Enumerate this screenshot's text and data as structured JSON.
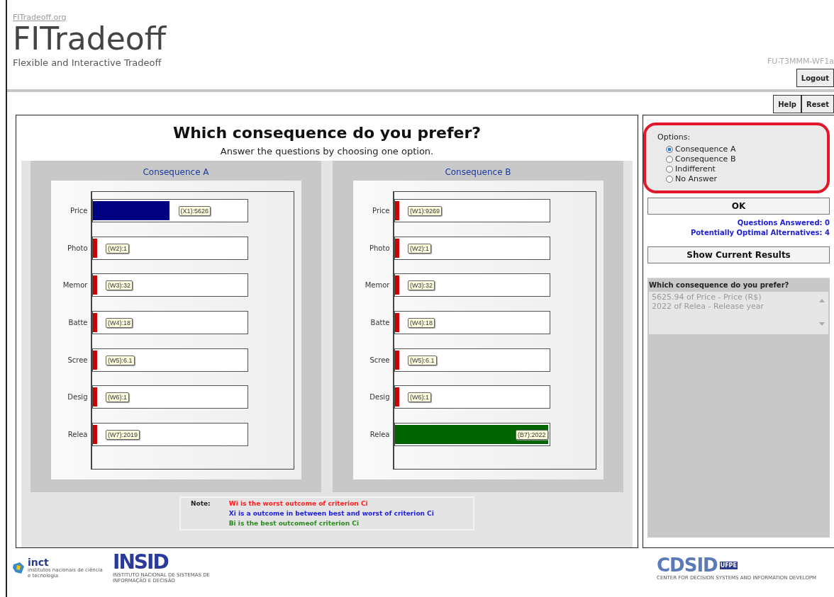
{
  "header": {
    "site_link": "FITradeoff.org",
    "title": "FITradeoff",
    "subtitle": "Flexible and Interactive Tradeoff",
    "user_code": "FU-T3MMM-WF1a",
    "logout": "Logout",
    "help": "Help",
    "reset": "Reset"
  },
  "question": {
    "title": "Which consequence do you prefer?",
    "instruction": "Answer the questions by choosing one option."
  },
  "consequences": [
    {
      "title": "Consequence A",
      "rows": [
        {
          "criterion": "Price",
          "kind": "between",
          "level": 0.5,
          "tag": "(X1):5626"
        },
        {
          "criterion": "Photo",
          "kind": "worst",
          "level": 0.03,
          "tag": "(W2):1"
        },
        {
          "criterion": "Memor",
          "kind": "worst",
          "level": 0.03,
          "tag": "(W3):32"
        },
        {
          "criterion": "Batte",
          "kind": "worst",
          "level": 0.03,
          "tag": "(W4):18"
        },
        {
          "criterion": "Scree",
          "kind": "worst",
          "level": 0.03,
          "tag": "(W5):6.1"
        },
        {
          "criterion": "Desig",
          "kind": "worst",
          "level": 0.03,
          "tag": "(W6):1"
        },
        {
          "criterion": "Relea",
          "kind": "worst",
          "level": 0.03,
          "tag": "(W7):2019"
        }
      ]
    },
    {
      "title": "Consequence B",
      "rows": [
        {
          "criterion": "Price",
          "kind": "worst",
          "level": 0.03,
          "tag": "(W1):9269"
        },
        {
          "criterion": "Photo",
          "kind": "worst",
          "level": 0.03,
          "tag": "(W2):1"
        },
        {
          "criterion": "Memor",
          "kind": "worst",
          "level": 0.03,
          "tag": "(W3):32"
        },
        {
          "criterion": "Batte",
          "kind": "worst",
          "level": 0.03,
          "tag": "(W4):18"
        },
        {
          "criterion": "Scree",
          "kind": "worst",
          "level": 0.03,
          "tag": "(W5):6.1"
        },
        {
          "criterion": "Desig",
          "kind": "worst",
          "level": 0.03,
          "tag": "(W6):1"
        },
        {
          "criterion": "Relea",
          "kind": "best",
          "level": 1,
          "tag": "(B7):2022"
        }
      ]
    }
  ],
  "note": {
    "label": "Note:",
    "lines": [
      {
        "text": "Wi is the worst outcome of criterion Ci",
        "color": "#ff2020"
      },
      {
        "text": "Xi is a outcome in between best and worst of criterion Ci",
        "color": "#2020e0"
      },
      {
        "text": "Bi is the best outcomeof criterion Ci",
        "color": "#2e8b22"
      }
    ]
  },
  "options": {
    "label": "Options:",
    "items": [
      {
        "label": "Consequence A",
        "selected": true
      },
      {
        "label": "Consequence B",
        "selected": false
      },
      {
        "label": "Indifferent",
        "selected": false
      },
      {
        "label": "No Answer",
        "selected": false
      }
    ]
  },
  "ok_button": "OK",
  "stats": [
    "Questions Answered: 0",
    "Potentially Optimal Alternatives: 4"
  ],
  "results_button": "Show Current Results",
  "summary": {
    "title": "Which consequence do you prefer?",
    "lines": [
      "5625.94 of Price - Price (R$)",
      "2022 of Relea - Release year"
    ]
  },
  "footer": {
    "inct_name": "inct",
    "inct_caption": "institutos nacionais de ciência e tecnologia",
    "insid_name": "INSID",
    "insid_caption": "INSTITUTO NACIONAL DE SISTEMAS DE INFORMAÇÃO E DECISÃO",
    "cdsid_name": "CDSID",
    "cdsid_badge": "UFPE",
    "cdsid_caption": "CENTER FOR DECISION SYSTEMS AND INFORMATION DEVELOPM"
  }
}
